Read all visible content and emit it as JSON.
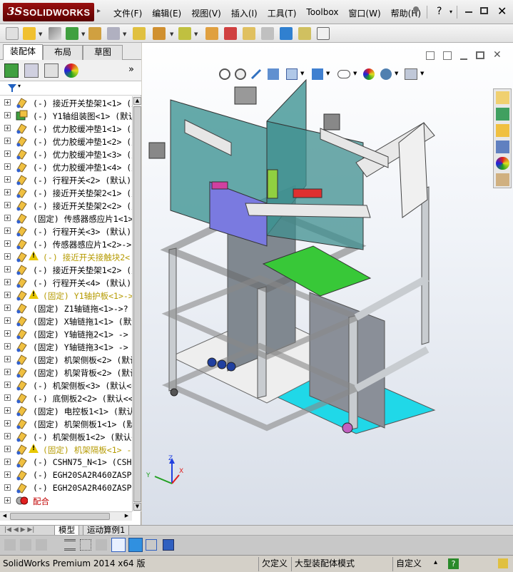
{
  "app": {
    "logo_ds": "3S",
    "logo_text": "SOLIDWORKS"
  },
  "menu": [
    "文件(F)",
    "编辑(E)",
    "视图(V)",
    "插入(I)",
    "工具(T)",
    "Toolbox",
    "窗口(W)",
    "帮助(H)"
  ],
  "panel_tabs": [
    "装配体",
    "布局",
    "草图"
  ],
  "tree": [
    {
      "label": "(-) 接近开关垫架1<1> (默",
      "style": "normal",
      "warn": false
    },
    {
      "label": "(-) Y1轴组装图<1> (默认",
      "style": "normal",
      "warn": false
    },
    {
      "label": "(-) 优力胶缓冲垫1<1> (默",
      "style": "normal",
      "warn": false
    },
    {
      "label": "(-) 优力胶缓冲垫1<2> (默",
      "style": "normal",
      "warn": false
    },
    {
      "label": "(-) 优力胶缓冲垫1<3> (默",
      "style": "normal",
      "warn": false
    },
    {
      "label": "(-) 优力胶缓冲垫1<4> (默",
      "style": "normal",
      "warn": false
    },
    {
      "label": "(-) 行程开关<2> (默认)",
      "style": "normal",
      "warn": false
    },
    {
      "label": "(-) 接近开关垫架2<1> (默",
      "style": "normal",
      "warn": false
    },
    {
      "label": "(-) 接近开关垫架2<2> (默",
      "style": "normal",
      "warn": false
    },
    {
      "label": "(固定) 传感器感应片1<1>",
      "style": "normal",
      "warn": false
    },
    {
      "label": "(-) 行程开关<3> (默认)",
      "style": "normal",
      "warn": false
    },
    {
      "label": "(-) 传感器感应片1<2>->?",
      "style": "normal",
      "warn": false
    },
    {
      "label": "(-) 接近开关接触块2<",
      "style": "yellow",
      "warn": true
    },
    {
      "label": "(-) 接近开关垫架1<2> (默",
      "style": "normal",
      "warn": false
    },
    {
      "label": "(-) 行程开关<4> (默认)",
      "style": "normal",
      "warn": false
    },
    {
      "label": "(固定) Y1轴护板<1>->",
      "style": "yellow",
      "warn": true
    },
    {
      "label": "(固定) Z1轴链拖<1>->? (",
      "style": "normal",
      "warn": false
    },
    {
      "label": "(固定) X轴链拖1<1> (默认",
      "style": "normal",
      "warn": false
    },
    {
      "label": "(固定) Y轴链拖2<1> -> (",
      "style": "normal",
      "warn": false
    },
    {
      "label": "(固定) Y轴链拖3<1> -> (",
      "style": "normal",
      "warn": false
    },
    {
      "label": "(固定) 机架侧板<2> (默认",
      "style": "normal",
      "warn": false
    },
    {
      "label": "(固定) 机架背板<2> (默认",
      "style": "normal",
      "warn": false
    },
    {
      "label": "(-) 机架侧板<3> (默认<<",
      "style": "normal",
      "warn": false
    },
    {
      "label": "(-) 底侧板2<2> (默认<<默",
      "style": "normal",
      "warn": false
    },
    {
      "label": "(固定) 电控板1<1> (默认",
      "style": "normal",
      "warn": false
    },
    {
      "label": "(固定) 机架侧板1<1> (默",
      "style": "normal",
      "warn": false
    },
    {
      "label": "(-) 机架侧板1<2> (默认<",
      "style": "normal",
      "warn": false
    },
    {
      "label": "(固定) 机架隔板<1> -",
      "style": "yellow",
      "warn": true
    },
    {
      "label": "(-) CSHN75_N<1> (CSHN75",
      "style": "normal",
      "warn": false
    },
    {
      "label": "(-) EGH20SA2R460ZASP <1",
      "style": "normal",
      "warn": false
    },
    {
      "label": "(-) EGH20SA2R460ZASP <2",
      "style": "normal",
      "warn": false
    },
    {
      "label": "配合",
      "style": "red",
      "warn": false
    }
  ],
  "bottom_tabs": [
    "模型",
    "运动算例1"
  ],
  "status": {
    "product": "SolidWorks Premium 2014 x64 版",
    "defined": "欠定义",
    "mode": "大型装配体模式",
    "custom": "自定义"
  },
  "triad": {
    "x": "X",
    "y": "Y",
    "z": "Z"
  },
  "colors": {
    "logo_red": "#8b0a0a",
    "frame_gray": "#c8ccd0",
    "panel_teal": "#4a9a9a",
    "base_cyan": "#20d8e8",
    "plate_green": "#38c838"
  }
}
